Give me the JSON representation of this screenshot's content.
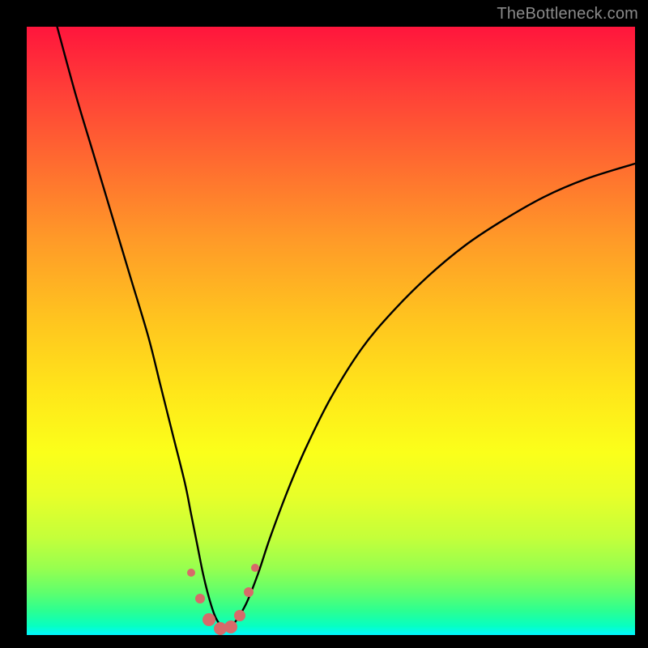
{
  "watermark": "TheBottleneck.com",
  "chart_data": {
    "type": "line",
    "title": "",
    "xlabel": "",
    "ylabel": "",
    "xlim": [
      0,
      100
    ],
    "ylim": [
      0,
      100
    ],
    "series": [
      {
        "name": "curve",
        "x": [
          5,
          8,
          11,
          14,
          17,
          20,
          22,
          24,
          26,
          27,
          28,
          29,
          30,
          31,
          32,
          33,
          34,
          36,
          38,
          40,
          43,
          46,
          50,
          55,
          60,
          66,
          72,
          78,
          85,
          92,
          100
        ],
        "y": [
          100,
          89,
          79,
          69,
          59,
          49,
          41,
          33,
          25,
          20,
          15,
          10,
          6,
          3,
          1.5,
          1,
          1.8,
          5,
          10,
          16,
          24,
          31,
          39,
          47,
          53,
          59,
          64,
          68,
          72,
          75,
          77.5
        ]
      }
    ],
    "markers": {
      "color": "#d76a6a",
      "points": [
        {
          "x": 27.0,
          "y": 10.2,
          "r": 5
        },
        {
          "x": 28.5,
          "y": 6.0,
          "r": 6
        },
        {
          "x": 30.0,
          "y": 2.5,
          "r": 8
        },
        {
          "x": 31.8,
          "y": 1.0,
          "r": 8
        },
        {
          "x": 33.5,
          "y": 1.3,
          "r": 8
        },
        {
          "x": 35.0,
          "y": 3.2,
          "r": 7
        },
        {
          "x": 36.5,
          "y": 7.0,
          "r": 6
        },
        {
          "x": 37.5,
          "y": 11.0,
          "r": 5
        }
      ]
    },
    "background_gradient": {
      "top": "#ff153c",
      "bottom": "#00f7ff"
    }
  }
}
